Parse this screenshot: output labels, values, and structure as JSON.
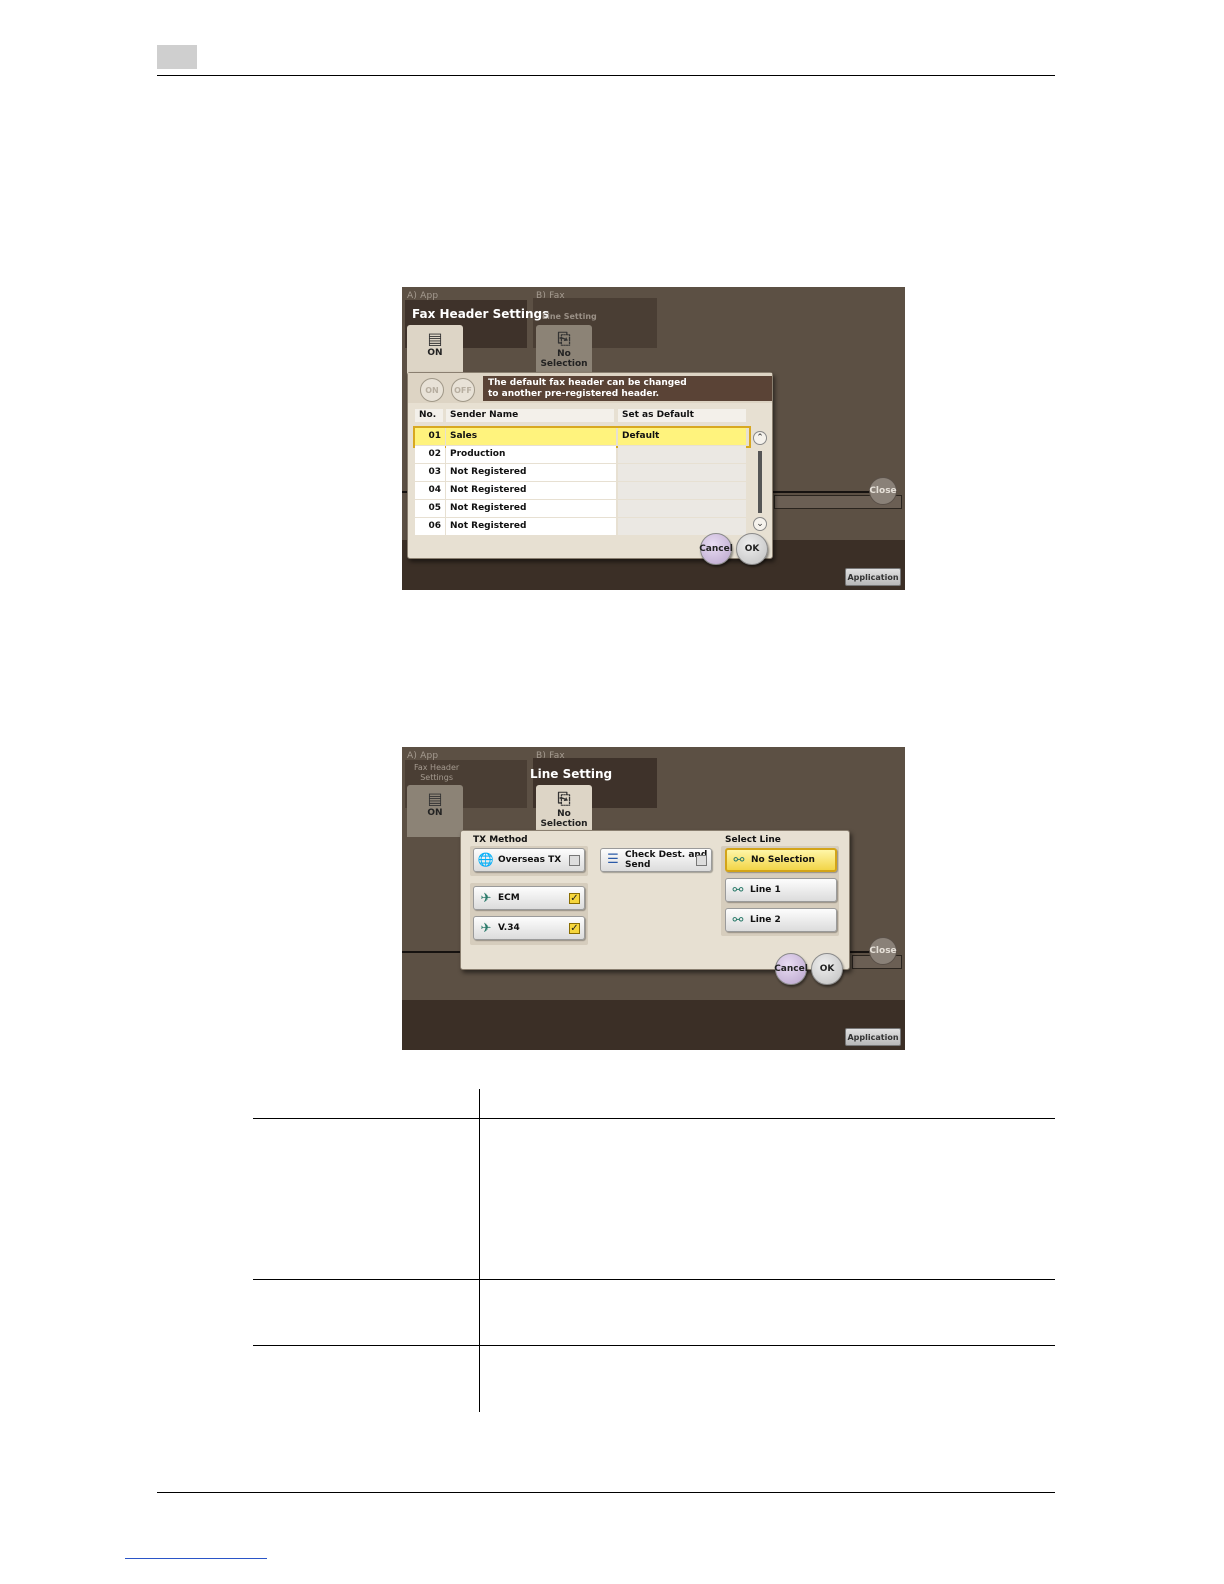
{
  "screen1": {
    "tab_a_header": "A)  App",
    "tab_b_header": "B)  Fax",
    "title": "Fax Header Settings",
    "app_tab_value": "ON",
    "fax_tab_label": "Line Setting",
    "fax_tab_value_1": "No",
    "fax_tab_value_2": "Selection",
    "toggle_on": "ON",
    "toggle_off": "OFF",
    "message_line1": "The default fax header can be changed",
    "message_line2": "to another pre-registered header.",
    "columns": [
      "No.",
      "Sender Name",
      "Set as Default"
    ],
    "rows": [
      {
        "no": "01",
        "name": "Sales",
        "default": "Default"
      },
      {
        "no": "02",
        "name": "Production",
        "default": ""
      },
      {
        "no": "03",
        "name": "Not Registered",
        "default": ""
      },
      {
        "no": "04",
        "name": "Not Registered",
        "default": ""
      },
      {
        "no": "05",
        "name": "Not Registered",
        "default": ""
      },
      {
        "no": "06",
        "name": "Not Registered",
        "default": ""
      }
    ],
    "cancel": "Cancel",
    "ok": "OK",
    "close": "Close",
    "application": "Application"
  },
  "screen2": {
    "tab_a_header": "A)  App",
    "tab_a_sub_1": "Fax Header",
    "tab_a_sub_2": "Settings",
    "tab_b_header": "B)  Fax",
    "title": "Line Setting",
    "app_tab_value": "ON",
    "fax_tab_value_1": "No",
    "fax_tab_value_2": "Selection",
    "tx_method_label": "TX Method",
    "overseas_tx": "Overseas TX",
    "ecm": "ECM",
    "v34": "V.34",
    "check_dest_1": "Check Dest. and",
    "check_dest_2": "Send",
    "select_line_label": "Select Line",
    "no_selection": "No Selection",
    "line1": "Line 1",
    "line2": "Line 2",
    "cancel": "Cancel",
    "ok": "OK",
    "close": "Close",
    "application": "Application"
  },
  "colors": {
    "screen_bg": "#5c5044",
    "message_bg": "#5a4336",
    "selected_row": "#fff37d"
  }
}
